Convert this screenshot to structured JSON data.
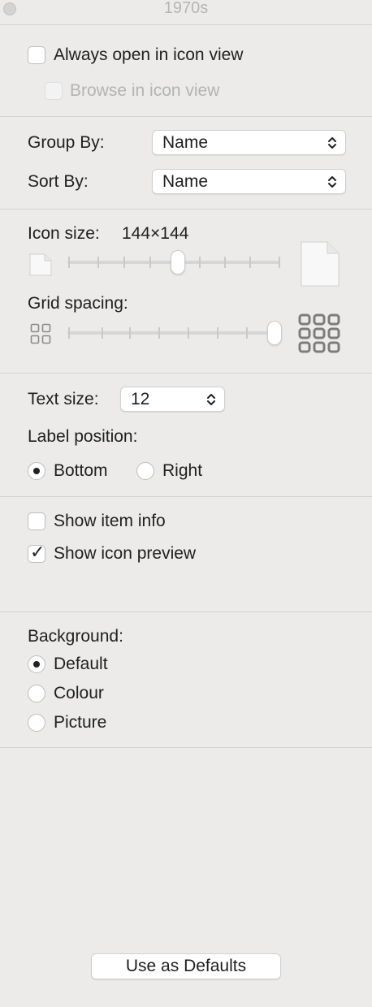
{
  "window": {
    "title": "1970s"
  },
  "view_options": {
    "always_open_icon_view": {
      "label": "Always open in icon view",
      "checked": false
    },
    "browse_icon_view": {
      "label": "Browse in icon view",
      "checked": false,
      "disabled": true
    }
  },
  "arrangement": {
    "group_by": {
      "label": "Group By:",
      "value": "Name"
    },
    "sort_by": {
      "label": "Sort By:",
      "value": "Name"
    }
  },
  "icon_size": {
    "label": "Icon size:",
    "value_text": "144×144",
    "slider_fraction": 0.5
  },
  "grid_spacing": {
    "label": "Grid spacing:",
    "slider_fraction": 1.0
  },
  "text": {
    "size_label": "Text size:",
    "size_value": "12",
    "label_position_label": "Label position:",
    "positions": [
      {
        "label": "Bottom",
        "selected": true
      },
      {
        "label": "Right",
        "selected": false
      }
    ]
  },
  "item_options": {
    "show_item_info": {
      "label": "Show item info",
      "checked": false
    },
    "show_icon_preview": {
      "label": "Show icon preview",
      "checked": true
    }
  },
  "background": {
    "label": "Background:",
    "options": [
      {
        "label": "Default",
        "selected": true
      },
      {
        "label": "Colour",
        "selected": false
      },
      {
        "label": "Picture",
        "selected": false
      }
    ]
  },
  "footer": {
    "defaults_button": "Use as Defaults"
  }
}
